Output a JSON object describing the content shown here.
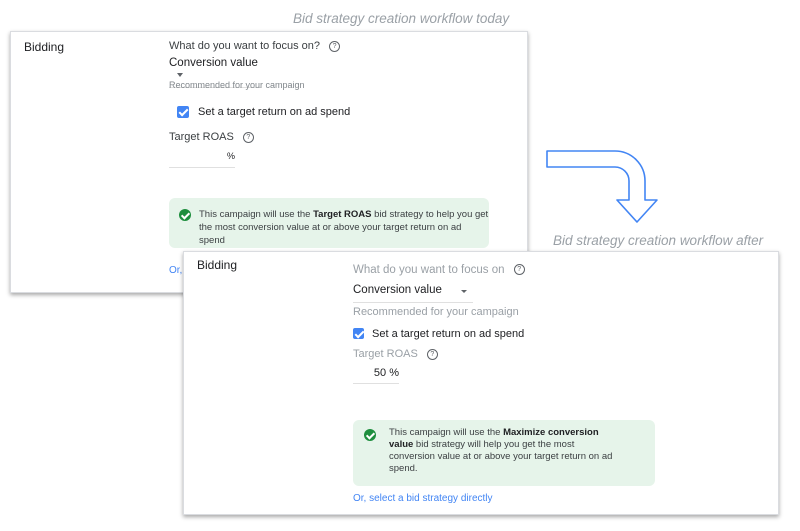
{
  "captions": {
    "today": "Bid strategy creation workflow today",
    "after": "Bid strategy creation workflow after"
  },
  "colors": {
    "accent": "#4285f4",
    "success": "#1e8e3e",
    "notice_bg": "#e6f4ea"
  },
  "today": {
    "section": "Bidding",
    "focus_question": "What do you want to focus on?",
    "focus_value": "Conversion value",
    "recommended": "Recommended for your campaign",
    "checkbox_label": "Set a target return on ad spend",
    "checkbox_checked": true,
    "roas_label": "Target ROAS",
    "roas_value": "",
    "roas_suffix": "%",
    "notice_pre": "This campaign will use the ",
    "notice_bold": "Target ROAS",
    "notice_post": " bid strategy to help you get the most conversion value at or above your target return on ad spend",
    "link_visible": "Or,"
  },
  "after": {
    "section": "Bidding",
    "focus_question": "What do you want to focus on",
    "focus_value": "Conversion value",
    "recommended": "Recommended for your campaign",
    "checkbox_label": "Set a target return on ad spend",
    "checkbox_checked": true,
    "roas_label": "Target ROAS",
    "roas_value": "50 %",
    "notice_pre": "This campaign will use the ",
    "notice_bold": "Maximize conversion value",
    "notice_post": " bid strategy will help you get the most conversion value at or above your target return on ad spend.",
    "link": "Or, select a bid strategy directly"
  },
  "icons": {
    "help": "?",
    "arrow": "bent-arrow-down-icon"
  }
}
